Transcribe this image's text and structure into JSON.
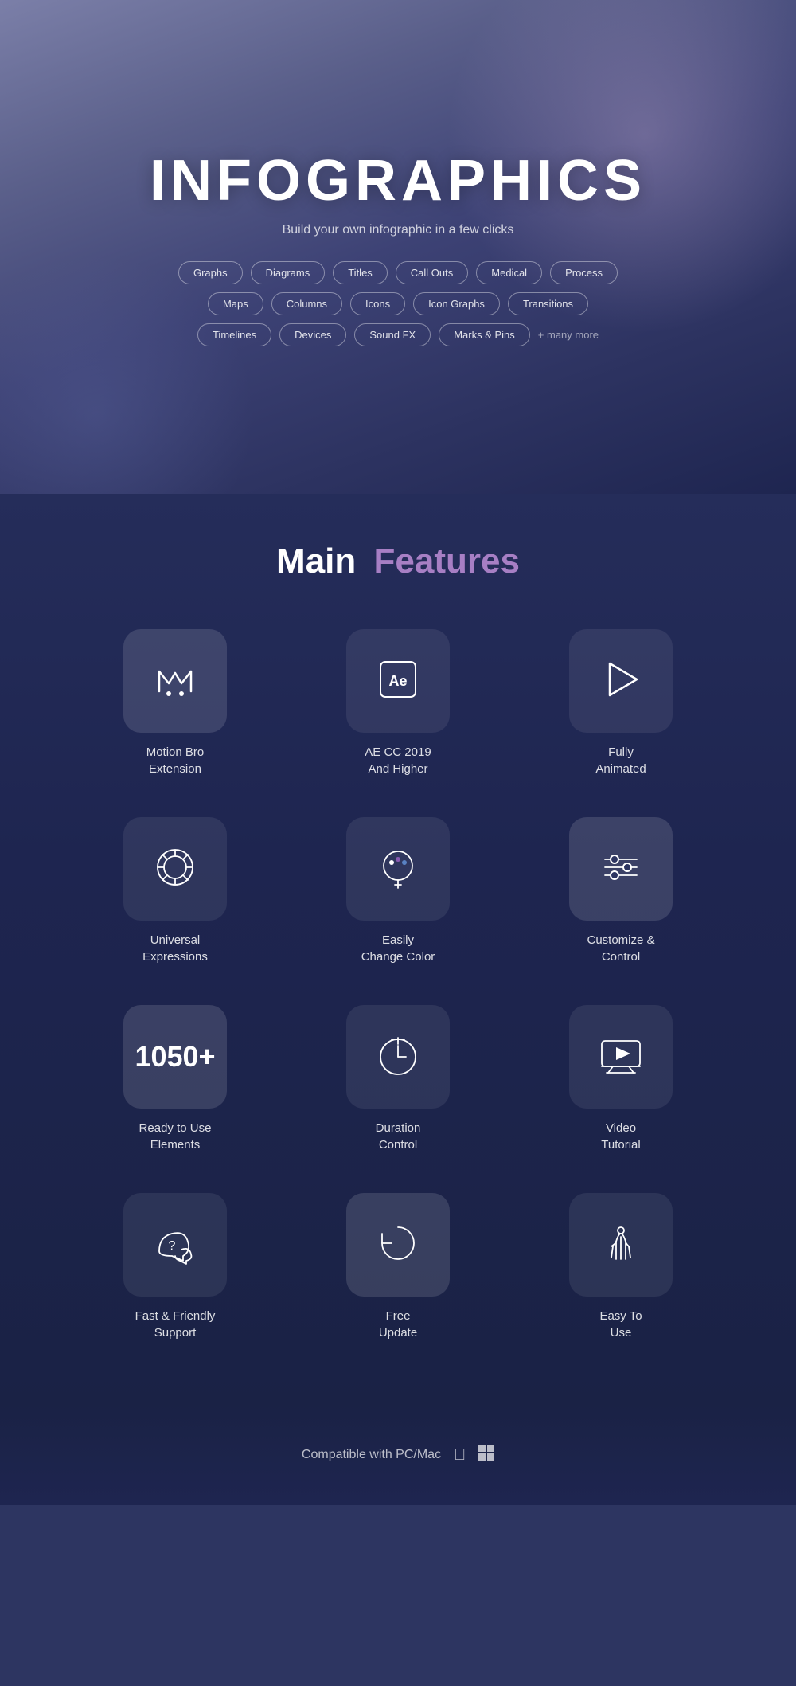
{
  "hero": {
    "title": "INFOGRAPHICS",
    "subtitle": "Build your own infographic in a few clicks",
    "tags_row1": [
      "Graphs",
      "Diagrams",
      "Titles",
      "Call Outs",
      "Medical",
      "Process"
    ],
    "tags_row2": [
      "Maps",
      "Columns",
      "Icons",
      "Icon Graphs",
      "Transitions"
    ],
    "tags_row3": [
      "Timelines",
      "Devices",
      "Sound FX",
      "Marks & Pins"
    ],
    "more": "+ many more"
  },
  "features": {
    "section_title_main": "Main",
    "section_title_accent": "Features",
    "items": [
      {
        "id": "motion-bro",
        "label": "Motion Bro\nExtension",
        "type": "icon",
        "highlighted": true
      },
      {
        "id": "ae-cc",
        "label": "AE CC 2019\nAnd Higher",
        "type": "icon"
      },
      {
        "id": "fully-animated",
        "label": "Fully\nAnimated",
        "type": "icon"
      },
      {
        "id": "universal-expressions",
        "label": "Universal\nExpressions",
        "type": "icon"
      },
      {
        "id": "change-color",
        "label": "Easily\nChange Color",
        "type": "icon"
      },
      {
        "id": "customize-control",
        "label": "Customize &\nControl",
        "type": "icon",
        "highlighted": true
      },
      {
        "id": "ready-elements",
        "label": "Ready to Use\nElements",
        "type": "number",
        "number": "1050+",
        "highlighted": true
      },
      {
        "id": "duration-control",
        "label": "Duration\nControl",
        "type": "icon"
      },
      {
        "id": "video-tutorial",
        "label": "Video\nTutorial",
        "type": "icon"
      },
      {
        "id": "fast-support",
        "label": "Fast & Friendly\nSupport",
        "type": "icon"
      },
      {
        "id": "free-update",
        "label": "Free\nUpdate",
        "type": "icon",
        "highlighted": true
      },
      {
        "id": "easy-to-use",
        "label": "Easy To\nUse",
        "type": "icon"
      }
    ]
  },
  "compatible": {
    "text": "Compatible with PC/Mac"
  }
}
